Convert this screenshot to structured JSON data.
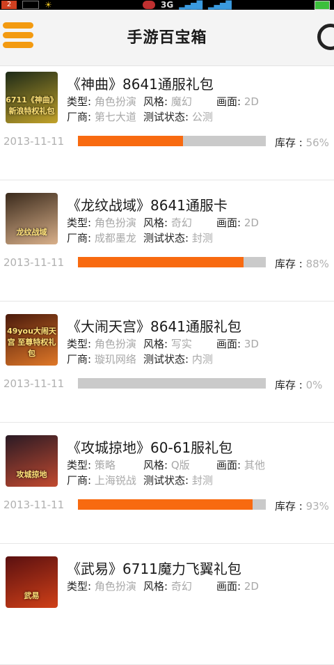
{
  "header": {
    "title": "手游百宝箱"
  },
  "statusbar": {
    "badge": "2",
    "network": "3G"
  },
  "labels": {
    "type": "类型:",
    "style": "风格:",
    "graphics": "画面:",
    "vendor": "厂商:",
    "test_status": "测试状态:",
    "stock": "库存 : "
  },
  "items": [
    {
      "name": "《神曲》8641通服礼包",
      "type": "角色扮演",
      "style": "魔幻",
      "graphics": "2D",
      "vendor": "第七大道",
      "test_status": "公测",
      "date": "2013-11-11",
      "stock": "56%",
      "stock_fraction": 0.56,
      "thumb_text": "6711《神曲》新浪特权礼包",
      "thumb_colors": [
        "#1d2a18",
        "#c2a22a"
      ]
    },
    {
      "name": "《龙纹战域》8641通服卡",
      "type": "角色扮演",
      "style": "奇幻",
      "graphics": "2D",
      "vendor": "成都墨龙",
      "test_status": "封测",
      "date": "2013-11-11",
      "stock": "88%",
      "stock_fraction": 0.88,
      "thumb_text": "龙纹战域",
      "thumb_colors": [
        "#3a2a1c",
        "#d9b08a"
      ]
    },
    {
      "name": "《大闹天宫》8641通服礼包",
      "type": "角色扮演",
      "style": "写实",
      "graphics": "3D",
      "vendor": "璇玑网络",
      "test_status": "内测",
      "date": "2013-11-11",
      "stock": "0%",
      "stock_fraction": 0.0,
      "thumb_text": "49you大闹天宫 至尊特权礼包",
      "thumb_colors": [
        "#4a1a0c",
        "#e07828"
      ]
    },
    {
      "name": "《攻城掠地》60-61服礼包",
      "type": "策略",
      "style": "Q版",
      "graphics": "其他",
      "vendor": "上海锐战",
      "test_status": "封测",
      "date": "2013-11-11",
      "stock": "93%",
      "stock_fraction": 0.93,
      "thumb_text": "攻城掠地",
      "thumb_colors": [
        "#2a1a24",
        "#c24a30"
      ]
    },
    {
      "name": "《武易》6711魔力飞翼礼包",
      "type": "角色扮演",
      "style": "奇幻",
      "graphics": "2D",
      "vendor": "",
      "test_status": "",
      "date": "",
      "stock": "",
      "stock_fraction": 0,
      "thumb_text": "武易",
      "thumb_colors": [
        "#5a1010",
        "#d04018"
      ]
    }
  ]
}
